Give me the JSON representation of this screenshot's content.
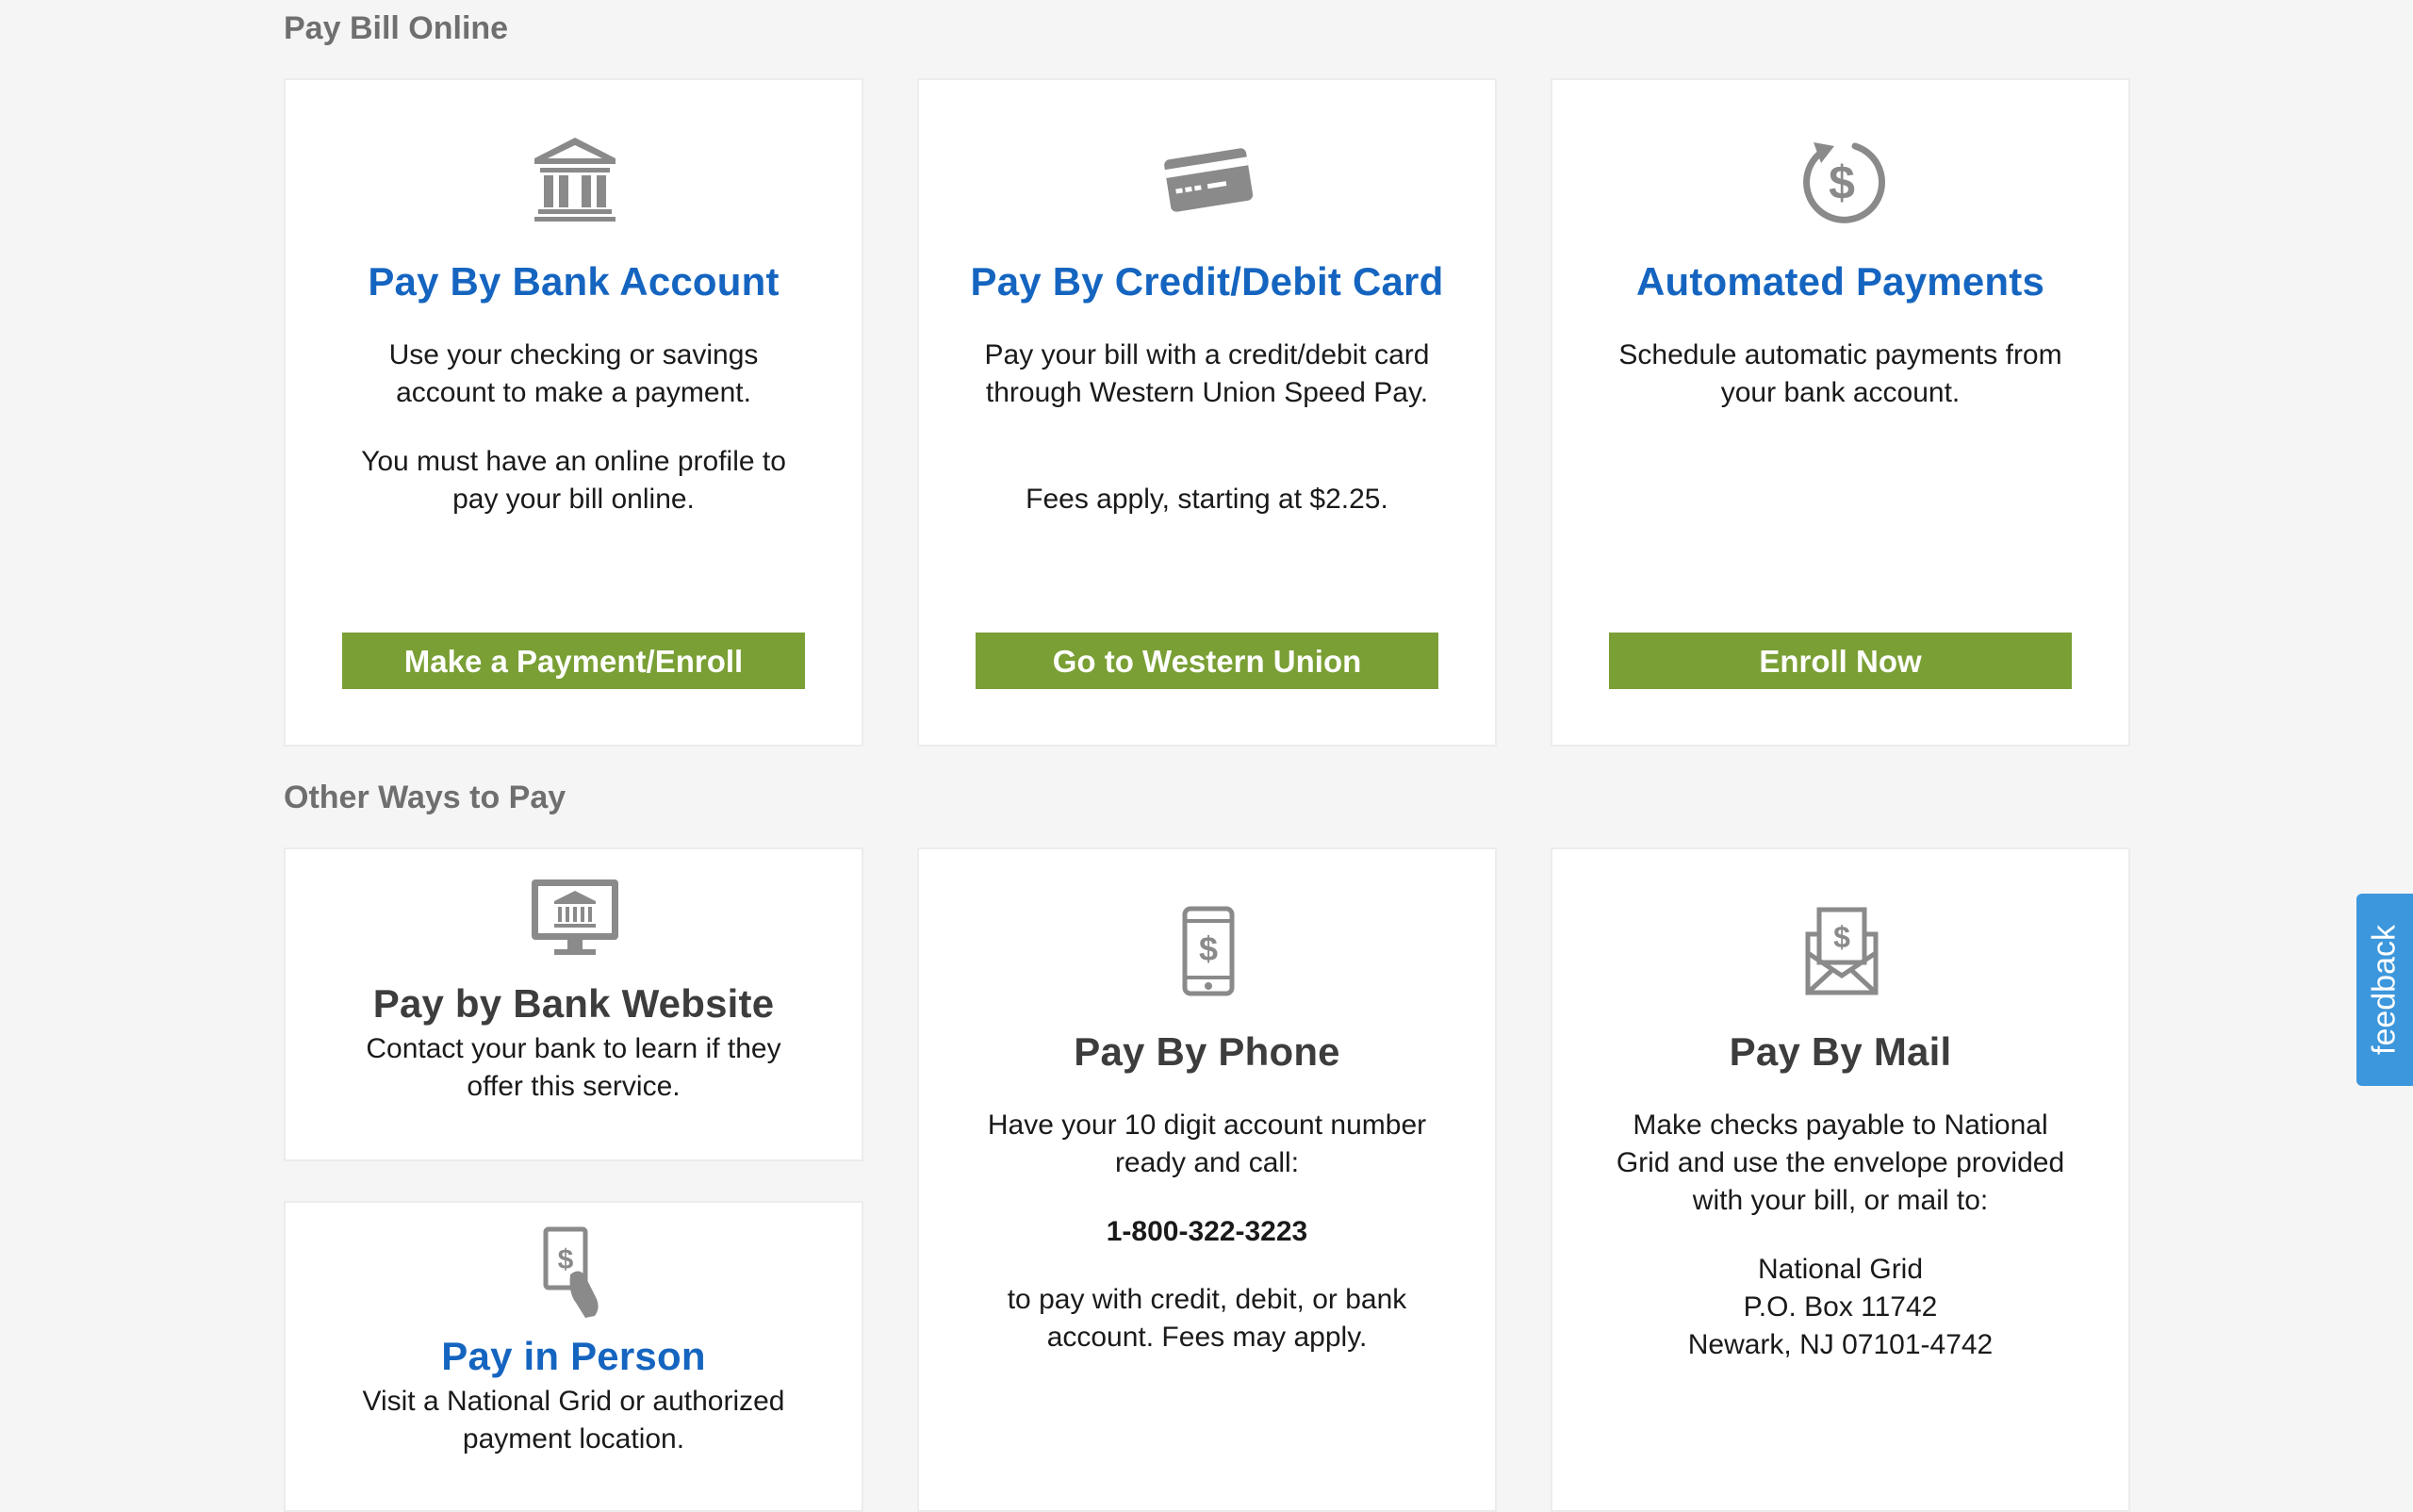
{
  "sections": {
    "online_title": "Pay Bill Online",
    "other_title": "Other Ways to Pay"
  },
  "online": {
    "bank": {
      "title": "Pay By Bank Account",
      "desc1": "Use your checking or savings account to make a payment.",
      "desc2": "You must have an online profile to pay your bill online.",
      "button": "Make a Payment/Enroll",
      "icon": "bank-icon"
    },
    "card": {
      "title": "Pay By Credit/Debit Card",
      "desc1": "Pay your bill with a credit/debit card through Western Union Speed Pay.",
      "desc2": "Fees apply, starting at $2.25.",
      "button": "Go to Western Union",
      "icon": "credit-card-icon"
    },
    "auto": {
      "title": "Automated Payments",
      "desc1": "Schedule automatic payments from your bank account.",
      "button": "Enroll Now",
      "icon": "recurring-dollar-icon"
    }
  },
  "other": {
    "bank_website": {
      "title": "Pay by Bank Website",
      "desc": "Contact your bank to learn if they offer this service.",
      "icon": "monitor-bank-icon"
    },
    "in_person": {
      "title": "Pay in Person",
      "desc": "Visit a National Grid or authorized payment location.",
      "icon": "hand-bill-icon"
    },
    "phone": {
      "title": "Pay By Phone",
      "desc1": "Have your 10 digit account number ready and call:",
      "number": "1-800-322-3223",
      "desc2": "to pay with credit, debit, or bank account. Fees may apply.",
      "icon": "phone-dollar-icon"
    },
    "mail": {
      "title": "Pay By Mail",
      "desc1": "Make checks payable to National Grid and use the envelope provided with your bill, or mail to:",
      "address_line1": "National Grid",
      "address_line2": "P.O. Box 11742",
      "address_line3": "Newark, NJ 07101-4742",
      "icon": "envelope-dollar-icon"
    }
  },
  "feedback": {
    "label": "feedback"
  },
  "colors": {
    "link_blue": "#1565c0",
    "button_green": "#7a9f35",
    "feedback_blue": "#3d97dc",
    "heading_gray": "#6f6f6f"
  }
}
